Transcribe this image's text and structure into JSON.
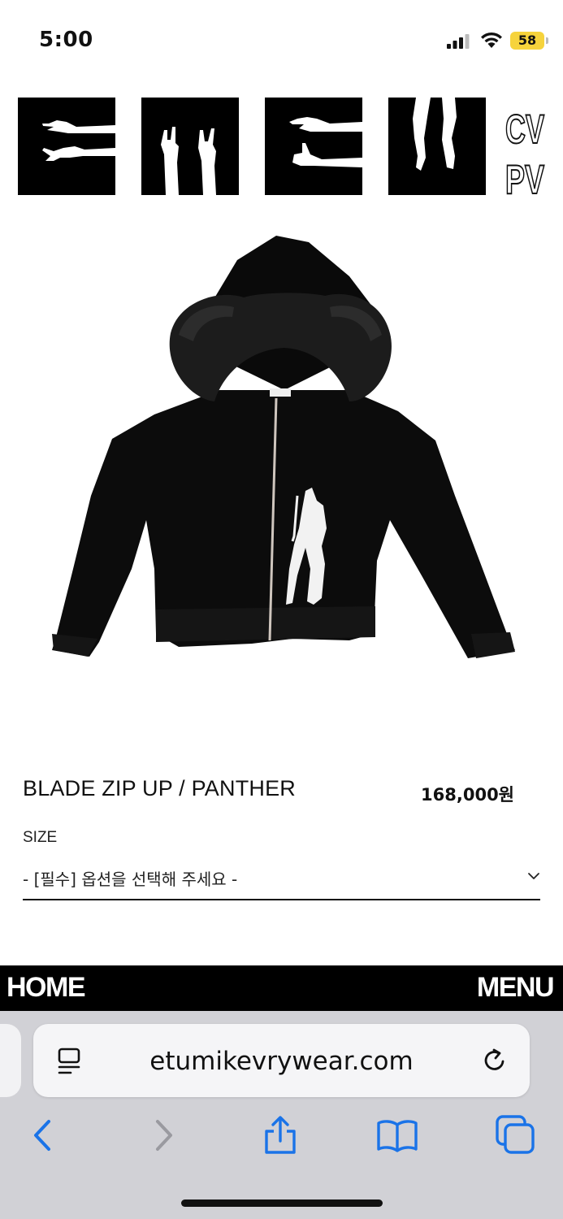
{
  "status_bar": {
    "time": "5:00",
    "battery": "58",
    "icons": [
      "signal-icon",
      "wifi-icon",
      "battery-icon"
    ],
    "battery_color": "#f6d33c"
  },
  "header": {
    "logo_tiles": [
      "reaching-arms-icon",
      "rock-hands-icon",
      "middle-finger-arms-icon",
      "legs-icon"
    ],
    "brand_mark": "CV PV"
  },
  "product": {
    "name": "BLADE ZIP UP / PANTHER",
    "price": "168,000원",
    "image_icon": "fur-hood-zip-up-hoodie-image",
    "option_label": "SIZE",
    "option_placeholder": "- [필수] 옵션을 선택해 주세요 -"
  },
  "bottom_nav": {
    "home_label": "HOME",
    "menu_label": "MENU"
  },
  "browser": {
    "url": "etumikevrywear.com",
    "toolbar_icons": [
      "back-icon",
      "forward-icon",
      "share-icon",
      "bookmarks-icon",
      "tabs-icon"
    ],
    "accent_color": "#1a73e8"
  }
}
